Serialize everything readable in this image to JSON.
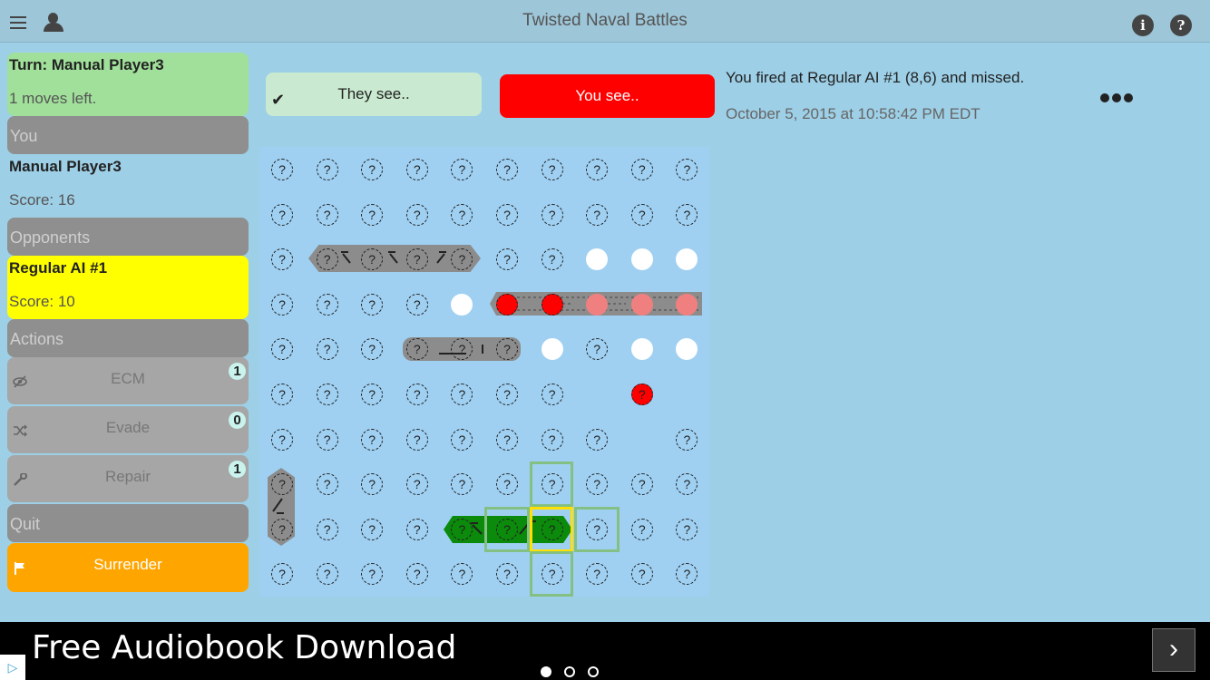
{
  "app": {
    "title": "Twisted Naval Battles"
  },
  "header": {
    "info_glyph": "i",
    "help_glyph": "?"
  },
  "turn": {
    "label": "Turn: Manual Player3",
    "moves": "1 moves left."
  },
  "you": {
    "section": "You",
    "name": "Manual Player3",
    "score": "Score: 16"
  },
  "opponents": {
    "section": "Opponents",
    "name": "Regular AI #1",
    "score": "Score: 10"
  },
  "actions": {
    "section": "Actions",
    "items": [
      {
        "label": "ECM",
        "count": "1",
        "icon": "eye-slash-icon"
      },
      {
        "label": "Evade",
        "count": "0",
        "icon": "shuffle-icon"
      },
      {
        "label": "Repair",
        "count": "1",
        "icon": "wrench-icon"
      }
    ]
  },
  "quit": {
    "section": "Quit",
    "surrender": "Surrender"
  },
  "view": {
    "they_see": "They see..",
    "you_see": "You see..",
    "check": "✔"
  },
  "message": {
    "text": "You fired at Regular AI #1 (8,6) and missed.",
    "date": "October 5, 2015 at 10:58:42 PM EDT"
  },
  "board": {
    "unknown_glyph": "?",
    "rows": [
      [
        "q",
        "q",
        "q",
        "q",
        "q",
        "q",
        "q",
        "q",
        "q",
        "q"
      ],
      [
        "q",
        "q",
        "q",
        "q",
        "q",
        "q",
        "q",
        "q",
        "q",
        "q"
      ],
      [
        "q",
        "sq",
        "sq",
        "sq",
        "sq",
        "q",
        "q",
        "m",
        "m",
        "m"
      ],
      [
        "q",
        "q",
        "q",
        "q",
        "m",
        "h",
        "h",
        "s",
        "s",
        "s"
      ],
      [
        "q",
        "q",
        "q",
        "sq",
        "sq",
        "sq",
        "m",
        "q",
        "m",
        "m"
      ],
      [
        "q",
        "q",
        "q",
        "q",
        "q",
        "q",
        "q",
        "e",
        "hq",
        "e"
      ],
      [
        "q",
        "q",
        "q",
        "q",
        "q",
        "q",
        "q",
        "q",
        "e",
        "q"
      ],
      [
        "sq",
        "q",
        "q",
        "q",
        "q",
        "q",
        "q",
        "q",
        "q",
        "q"
      ],
      [
        "sq",
        "q",
        "q",
        "q",
        "sq",
        "sq",
        "sq",
        "q",
        "q",
        "q"
      ],
      [
        "q",
        "q",
        "q",
        "q",
        "q",
        "q",
        "q",
        "q",
        "q",
        "q"
      ]
    ]
  },
  "ad": {
    "text": "Free Audiobook Download",
    "arrow": "›",
    "choice": "▷",
    "pages": 3,
    "active": 0
  },
  "colors": {
    "turn": "#a0e09a",
    "opponent": "#ffff00",
    "you_see": "#ff0000",
    "surrender": "#ffa500",
    "player_ship": "#0b8a0b"
  }
}
